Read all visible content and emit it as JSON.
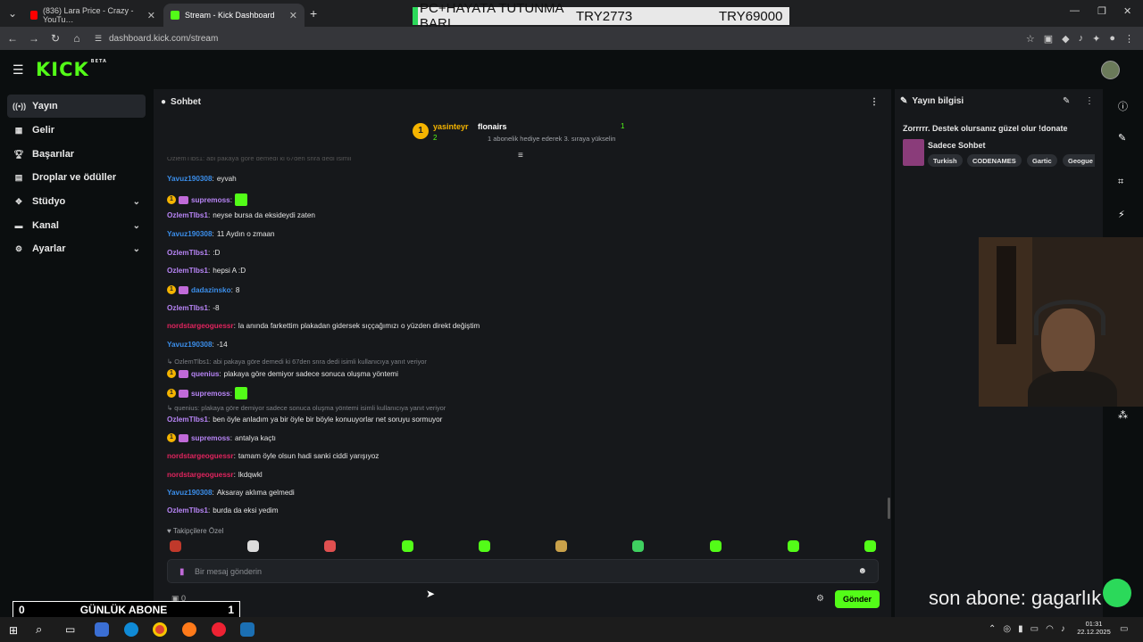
{
  "browser": {
    "tabs": [
      {
        "label": "(836) Lara Price - Crazy - YouTu…",
        "icon": "youtube-icon"
      },
      {
        "label": "Stream - Kick Dashboard",
        "icon": "kick-icon"
      }
    ],
    "url": "dashboard.kick.com/stream"
  },
  "overlay_banner": {
    "left": "PC+HAYATA TUTUNMA BARI",
    "mid": "TRY2773",
    "right": "TRY69000"
  },
  "kick": {
    "logo": "KICK",
    "logo_sup": "BETA"
  },
  "sidebar": {
    "items": [
      {
        "label": "Yayın",
        "icon": "broadcast-icon"
      },
      {
        "label": "Gelir",
        "icon": "dollar-icon"
      },
      {
        "label": "Başarılar",
        "icon": "trophy-icon"
      },
      {
        "label": "Droplar ve ödüller",
        "icon": "gift-icon"
      },
      {
        "label": "Stüdyo",
        "icon": "studio-icon"
      },
      {
        "label": "Kanal",
        "icon": "channel-icon"
      },
      {
        "label": "Ayarlar",
        "icon": "gear-icon"
      }
    ]
  },
  "chat": {
    "title": "Sohbet",
    "leaderboard": {
      "rank1_name": "yasinteyr",
      "rank1_count": "2",
      "sub_user": "flonairs",
      "sub_count": "1",
      "sub_note": "1 abonelik hediye ederek 3. sıraya yükselin"
    },
    "cut_line": "OzlemTlbs1: abi pakaya göre demedi ki 67den snra dedi isimli",
    "messages": [
      {
        "user": "Yavuz190308",
        "text": "eyvah",
        "color": "#3b8eea"
      },
      {
        "user": "supremoss",
        "text": "",
        "color": "#b784f5",
        "badges": true,
        "emote": true
      },
      {
        "user": "OzlemTlbs1",
        "text": "neyse bursa da eksideydi zaten",
        "color": "#b784f5"
      },
      {
        "user": "Yavuz190308",
        "text": "11 Aydın o zmaan",
        "color": "#3b8eea"
      },
      {
        "user": "OzlemTlbs1",
        "text": ":D",
        "color": "#b784f5"
      },
      {
        "user": "OzlemTlbs1",
        "text": "hepsi A :D",
        "color": "#b784f5"
      },
      {
        "user": "dadazinsko",
        "text": "8",
        "color": "#3b8eea",
        "badges": true
      },
      {
        "user": "OzlemTlbs1",
        "text": "-8",
        "color": "#b784f5"
      },
      {
        "user": "nordstargeoguessr",
        "text": "la anında farkettim plakadan gidersek sıççağımızı o yüzden direkt değiştim",
        "color": "#e0245e"
      },
      {
        "user": "Yavuz190308",
        "text": "-14",
        "color": "#3b8eea"
      },
      {
        "reply": "OzlemTlbs1: abi pakaya göre demedi ki 67den snra dedi isimli kullanıcıya yanıt veriyor"
      },
      {
        "user": "quenius",
        "text": "plakaya göre demiyor sadece sonuca oluşma yöntemi",
        "color": "#b784f5",
        "badges": true
      },
      {
        "user": "supremoss",
        "text": "",
        "color": "#b784f5",
        "badges": true,
        "emote": true
      },
      {
        "reply": "quenius: plakaya göre demiyor sadece sonuca oluşma yöntemi isimli kullanıcıya yanıt veriyor"
      },
      {
        "user": "OzlemTlbs1",
        "text": "ben öyle anladım ya bir öyle bir böyle konuuyorlar net soruyu sormuyor",
        "color": "#b784f5"
      },
      {
        "user": "supremoss",
        "text": "antalya kaçtı",
        "color": "#b784f5",
        "badges": true
      },
      {
        "user": "nordstargeoguessr",
        "text": "tamam öyle olsun hadi sanki ciddi yarışıyoz",
        "color": "#e0245e"
      },
      {
        "user": "nordstargeoguessr",
        "text": "lkdqwkl",
        "color": "#e0245e"
      },
      {
        "user": "Yavuz190308",
        "text": "Aksaray aklıma gelmedi",
        "color": "#3b8eea"
      },
      {
        "user": "OzlemTlbs1",
        "text": "burda da eksi yedim",
        "color": "#b784f5"
      }
    ],
    "followers_only": "Takipçilere Özel",
    "input_placeholder": "Bir mesaj gönderin",
    "send_label": "Gönder",
    "points": "0"
  },
  "stream_info": {
    "title": "Yayın bilgisi",
    "stream_title": "Zorrrrr. Destek olursanız güzel olur !donate",
    "category": "Sadece Sohbet",
    "tags": [
      "Turkish",
      "CODENAMES",
      "Gartic",
      "Geogue"
    ]
  },
  "overlays": {
    "sub_left": "0",
    "sub_label": "GÜNLÜK ABONE",
    "sub_right": "1",
    "last_sub": "son abone: gagarlık"
  },
  "taskbar": {
    "time": "01:31",
    "date": "22.12.2025"
  }
}
